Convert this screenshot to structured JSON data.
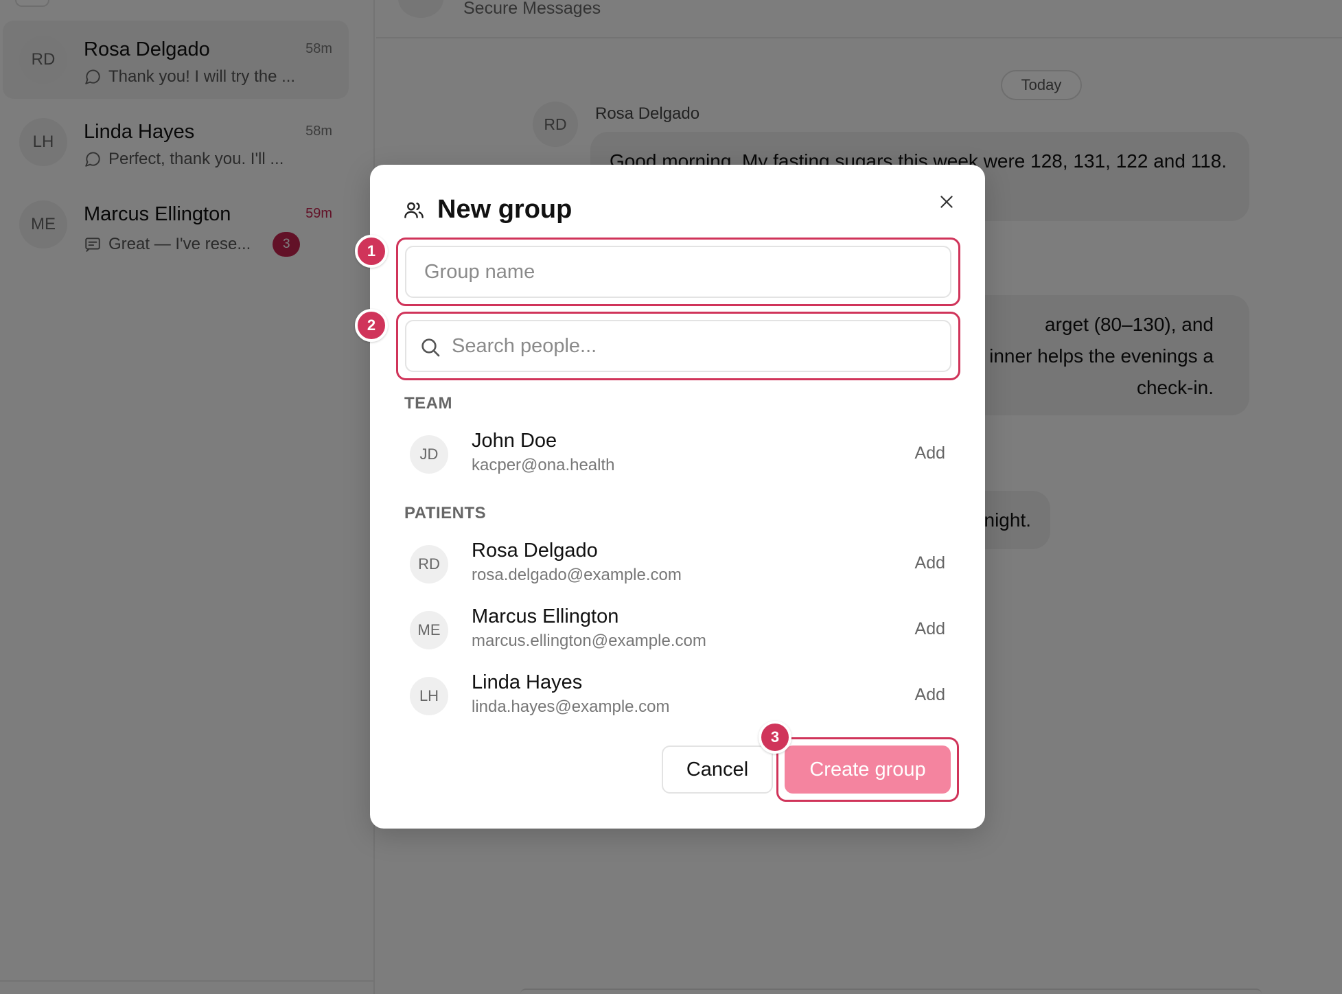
{
  "sidebar": {
    "conversations": [
      {
        "initials": "RD",
        "name": "Rosa Delgado",
        "time": "58m",
        "preview": "Thank you! I will try the ...",
        "unread": ""
      },
      {
        "initials": "LH",
        "name": "Linda Hayes",
        "time": "58m",
        "preview": "Perfect, thank you. I'll ...",
        "unread": ""
      },
      {
        "initials": "ME",
        "name": "Marcus Ellington",
        "time": "59m",
        "preview": "Great — I've rese...",
        "unread": "3"
      }
    ]
  },
  "main": {
    "header_subtitle": "Secure Messages",
    "date_divider": "Today",
    "message_sender_initials": "RD",
    "message_sender": "Rosa Delgado",
    "bubble_1": "Good morning. My fasting sugars this week were 128, 131, 122 and 118.",
    "bubble_2_line_1": "arget (80–130), and",
    "bubble_2_line_2": "inner helps the evenings a",
    "bubble_2_line_3": "check-in.",
    "bubble_3": "night."
  },
  "modal": {
    "title": "New group",
    "group_name_placeholder": "Group name",
    "search_placeholder": "Search people...",
    "team_label": "TEAM",
    "patients_label": "PATIENTS",
    "team": [
      {
        "initials": "JD",
        "name": "John Doe",
        "email": "kacper@ona.health",
        "action": "Add"
      }
    ],
    "patients": [
      {
        "initials": "RD",
        "name": "Rosa Delgado",
        "email": "rosa.delgado@example.com",
        "action": "Add"
      },
      {
        "initials": "ME",
        "name": "Marcus Ellington",
        "email": "marcus.ellington@example.com",
        "action": "Add"
      },
      {
        "initials": "LH",
        "name": "Linda Hayes",
        "email": "linda.hayes@example.com",
        "action": "Add"
      }
    ],
    "cancel_label": "Cancel",
    "create_label": "Create group"
  },
  "annotations": {
    "step_1": "1",
    "step_2": "2",
    "step_3": "3"
  },
  "colors": {
    "accent": "#d0345a",
    "create_button": "#f4849f",
    "unread_badge": "#c4234f"
  },
  "icons": {
    "title": "users-icon",
    "close": "close-icon",
    "search": "search-icon",
    "chat_preview": "chat-bubble-icon",
    "message_preview": "message-square-icon"
  }
}
